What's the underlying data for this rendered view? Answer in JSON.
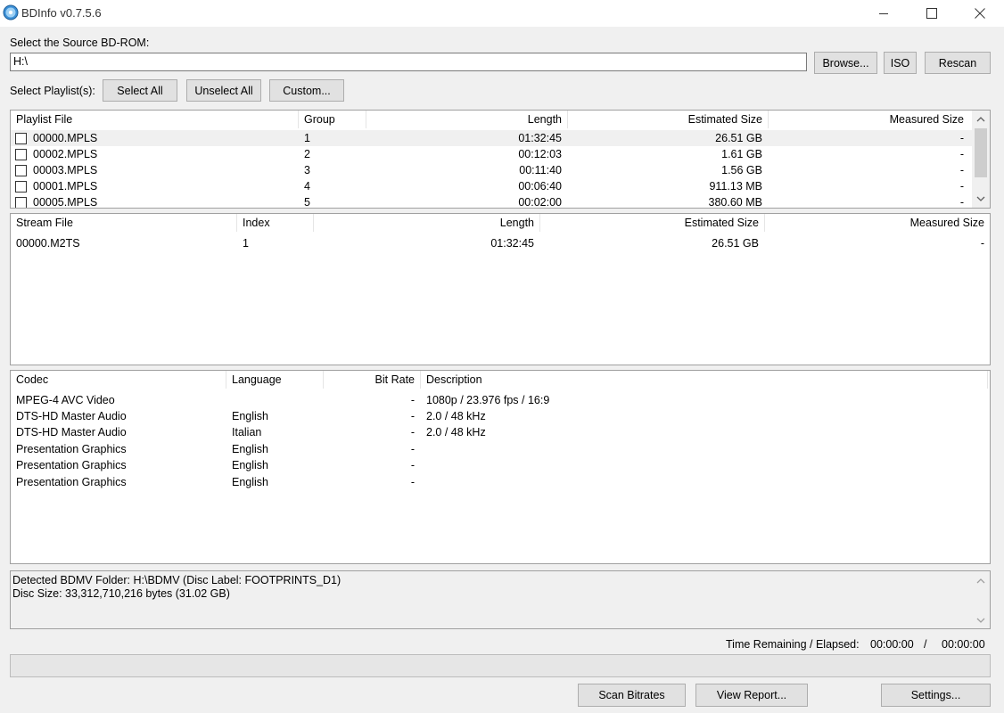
{
  "window": {
    "title": "BDInfo v0.7.5.6"
  },
  "source": {
    "label": "Select the Source BD-ROM:",
    "path_value": "H:\\",
    "browse_label": "Browse...",
    "iso_label": "ISO",
    "rescan_label": "Rescan"
  },
  "playlist_select": {
    "label": "Select Playlist(s):",
    "select_all": "Select All",
    "unselect_all": "Unselect All",
    "custom": "Custom..."
  },
  "playlists": {
    "headers": [
      "Playlist File",
      "Group",
      "Length",
      "Estimated Size",
      "Measured Size"
    ],
    "rows": [
      {
        "file": "00000.MPLS",
        "group": "1",
        "length": "01:32:45",
        "est": "26.51 GB",
        "meas": "-",
        "checked": false
      },
      {
        "file": "00002.MPLS",
        "group": "2",
        "length": "00:12:03",
        "est": "1.61 GB",
        "meas": "-",
        "checked": false
      },
      {
        "file": "00003.MPLS",
        "group": "3",
        "length": "00:11:40",
        "est": "1.56 GB",
        "meas": "-",
        "checked": false
      },
      {
        "file": "00001.MPLS",
        "group": "4",
        "length": "00:06:40",
        "est": "911.13 MB",
        "meas": "-",
        "checked": false
      },
      {
        "file": "00005.MPLS",
        "group": "5",
        "length": "00:02:00",
        "est": "380.60 MB",
        "meas": "-",
        "checked": false
      }
    ]
  },
  "streams": {
    "headers": [
      "Stream File",
      "Index",
      "Length",
      "Estimated Size",
      "Measured Size"
    ],
    "rows": [
      {
        "file": "00000.M2TS",
        "index": "1",
        "length": "01:32:45",
        "est": "26.51 GB",
        "meas": "-"
      }
    ]
  },
  "codecs": {
    "headers": [
      "Codec",
      "Language",
      "Bit Rate",
      "Description"
    ],
    "rows": [
      {
        "codec": "MPEG-4 AVC Video",
        "language": "",
        "bitrate": "-",
        "desc": "1080p / 23.976 fps / 16:9"
      },
      {
        "codec": "DTS-HD Master Audio",
        "language": "English",
        "bitrate": "-",
        "desc": "2.0 / 48 kHz"
      },
      {
        "codec": "DTS-HD Master Audio",
        "language": "Italian",
        "bitrate": "-",
        "desc": "2.0 / 48 kHz"
      },
      {
        "codec": "Presentation Graphics",
        "language": "English",
        "bitrate": "-",
        "desc": ""
      },
      {
        "codec": "Presentation Graphics",
        "language": "English",
        "bitrate": "-",
        "desc": ""
      },
      {
        "codec": "Presentation Graphics",
        "language": "English",
        "bitrate": "-",
        "desc": ""
      }
    ]
  },
  "status": {
    "line1": "Detected BDMV Folder: H:\\BDMV (Disc Label: FOOTPRINTS_D1)",
    "line2": "Disc Size: 33,312,710,216 bytes (31.02 GB)"
  },
  "time": {
    "label": "Time Remaining / Elapsed:",
    "remaining": "00:00:00",
    "separator": "/",
    "elapsed": "00:00:00"
  },
  "progress": 0,
  "buttons": {
    "scan_bitrates": "Scan Bitrates",
    "view_report": "View Report...",
    "settings": "Settings..."
  }
}
